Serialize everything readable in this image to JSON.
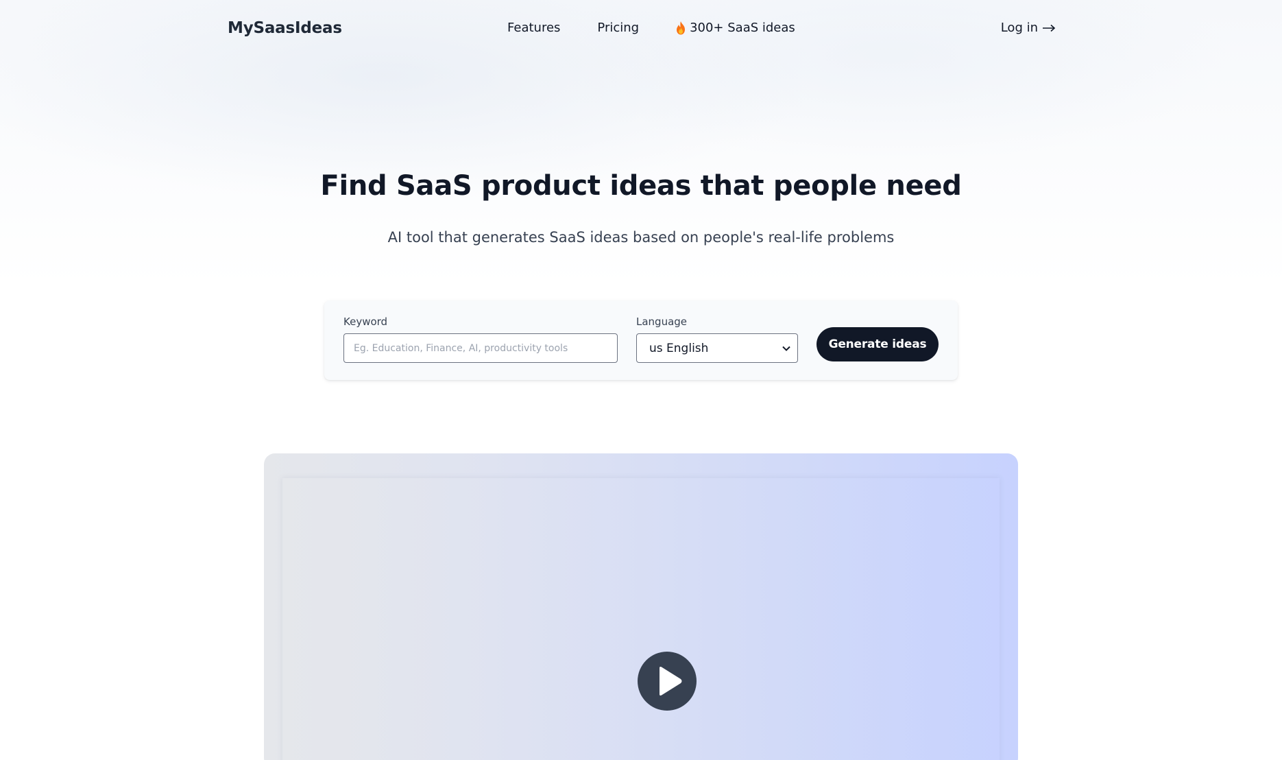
{
  "header": {
    "logo": "MySaasIdeas",
    "nav": {
      "features": "Features",
      "pricing": "Pricing",
      "ideas": "300+ SaaS ideas"
    },
    "login": "Log in"
  },
  "hero": {
    "title": "Find SaaS product ideas that people need",
    "subtitle": "AI tool that generates SaaS ideas based on people's real-life problems"
  },
  "search": {
    "keyword_label": "Keyword",
    "keyword_value": "",
    "keyword_placeholder": "Eg. Education, Finance, AI, productivity tools",
    "language_label": "Language",
    "language_value": "us English",
    "generate_label": "Generate ideas"
  },
  "colors": {
    "primary_dark": "#111827",
    "fire_orange": "#f97316",
    "play_button": "#374151",
    "video_gradient_end": "#c7d2fe"
  },
  "icons": {
    "ideas": "fire-icon",
    "login": "arrow-right-icon",
    "select": "chevron-down-icon",
    "video": "play-icon"
  }
}
